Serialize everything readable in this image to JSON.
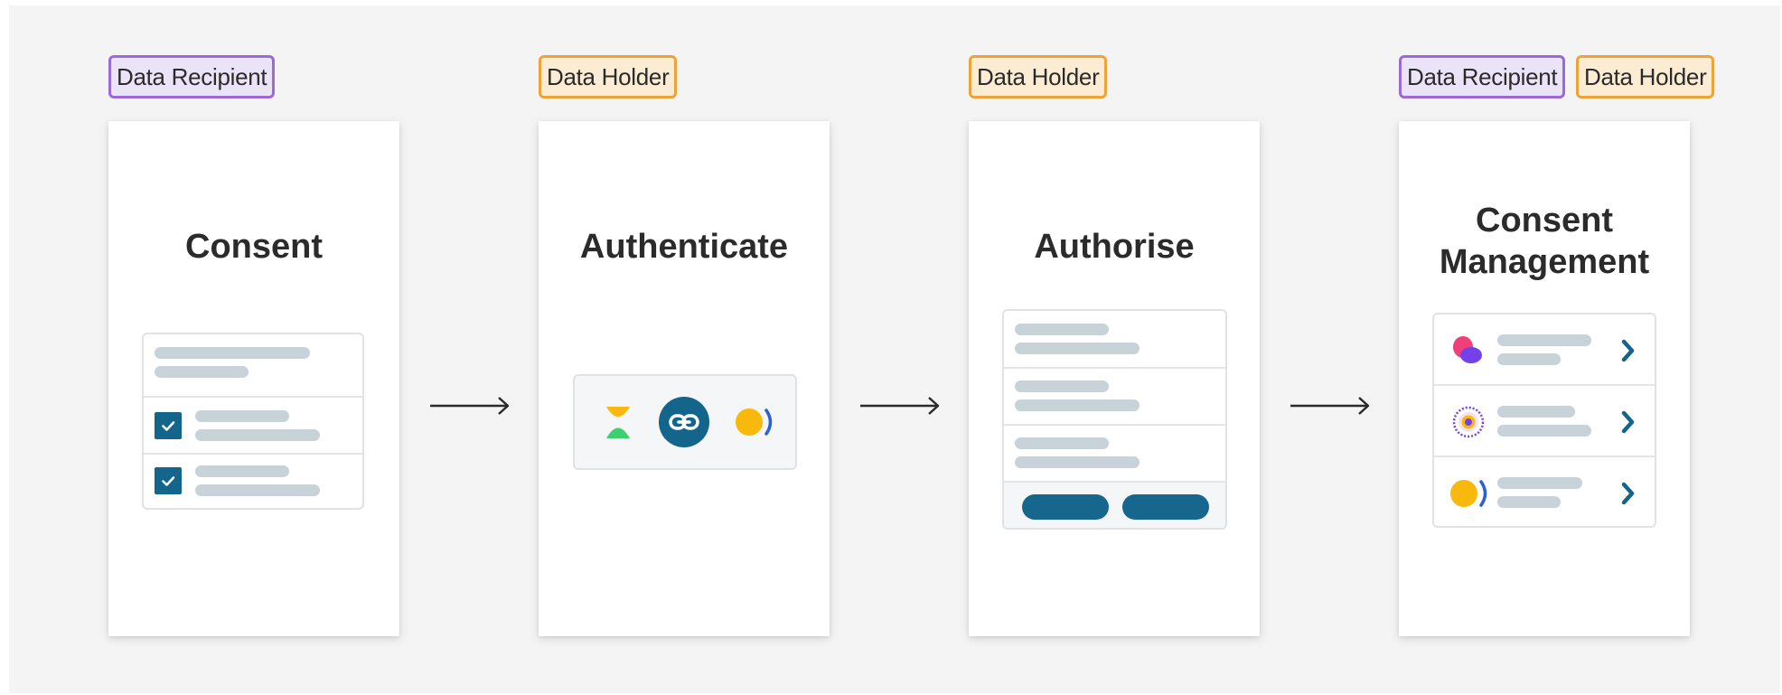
{
  "roles": {
    "data_recipient": "Data Recipient",
    "data_holder": "Data Holder"
  },
  "steps": [
    {
      "title": "Consent"
    },
    {
      "title": "Authenticate"
    },
    {
      "title": "Authorise"
    },
    {
      "title_line1": "Consent",
      "title_line2": "Management"
    }
  ],
  "colors": {
    "recipient_border": "#9b6ad6",
    "holder_border": "#eea338",
    "accent_blue": "#14658b",
    "placeholder_bar": "#c7d3d9",
    "logo_green": "#3ecf6e",
    "logo_yellow": "#f8b90c",
    "logo_pink": "#f0407a",
    "logo_purple": "#7440e8"
  },
  "icons": [
    "checkbox-checked-icon",
    "link-icon",
    "chevron-right-icon",
    "arrow-right-icon"
  ]
}
